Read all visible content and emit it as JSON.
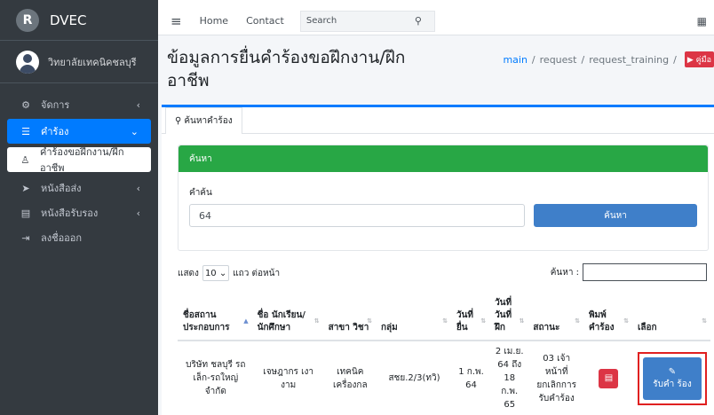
{
  "brand": {
    "logo_letter": "R",
    "name": "DVEC"
  },
  "user": {
    "name": "วิทยาลัยเทคนิคชลบุรี"
  },
  "sidebar": {
    "items": [
      {
        "label": "จัดการ",
        "icon": "gears-icon"
      },
      {
        "label": "คำร้อง",
        "icon": "list-icon"
      },
      {
        "label": "คำร้องขอฝึกงาน/ฝึกอาชีพ",
        "icon": "user-icon"
      },
      {
        "label": "หนังสือส่ง",
        "icon": "paper-plane-icon"
      },
      {
        "label": "หนังสือรับรอง",
        "icon": "file-icon"
      },
      {
        "label": "ลงชื่อออก",
        "icon": "sign-out-icon"
      }
    ]
  },
  "topbar": {
    "home": "Home",
    "contact": "Contact",
    "search_placeholder": "Search"
  },
  "page": {
    "title": "ข้อมูลการยื่นคำร้องขอฝึกงาน/ฝึกอาชีพ",
    "breadcrumb": [
      "main",
      "request",
      "request_training"
    ],
    "help_label": "คู่มือ"
  },
  "tab": {
    "label": "ค้นหาคำร้อง"
  },
  "search_panel": {
    "header": "ค้นหา",
    "keyword_label": "คำค้น",
    "keyword_value": "64",
    "submit_label": "ค้นหา"
  },
  "table_ctrl": {
    "show_label": "แสดง",
    "page_size": "10",
    "rows_per_page": "แถว ต่อหน้า",
    "filter_label": "ค้นหา :"
  },
  "table": {
    "headers": [
      "ชื่อสถาน ประกอบการ",
      "ชื่อ นักเรียน/ นักศึกษา",
      "สาขา วิชา",
      "กลุ่ม",
      "วันที่ ยื่น",
      "วันที่ วันที่ ฝึก",
      "สถานะ",
      "พิมพ์ คำร้อง",
      "เลือก"
    ],
    "rows": [
      {
        "company": "บริษัท ชลบุรี รถเล็ก-รถใหญ่ จำกัด",
        "student": "เจษฎากร เงา งาม",
        "department": "เทคนิค เครื่องกล",
        "group": "สชย.2/3(ทวิ)",
        "submit_date": "1 ก.พ. 64",
        "training_date": "2 เม.ย. 64 ถึง 18 ก.พ. 65",
        "status": "03 เจ้า หน้าที่ ยกเลิกการ รับคำร้อง",
        "print_label": "PDF",
        "action_label": "รับคำ ร้อง"
      }
    ]
  }
}
